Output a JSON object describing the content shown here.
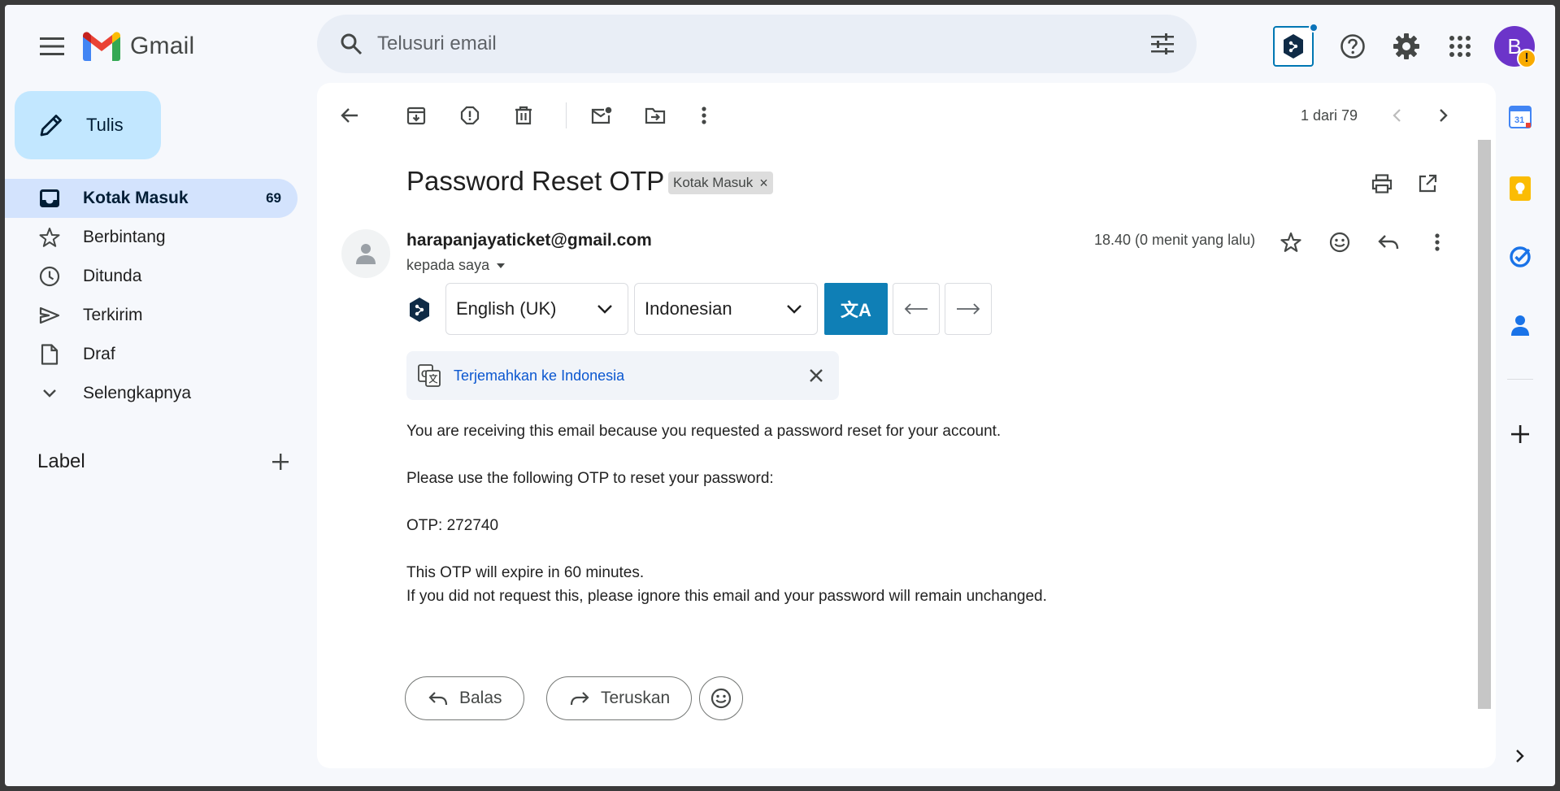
{
  "app": {
    "name": "Gmail"
  },
  "search": {
    "placeholder": "Telusuri email"
  },
  "user": {
    "avatar_initial": "B",
    "warning_glyph": "!"
  },
  "sidebar": {
    "compose_label": "Tulis",
    "items": [
      {
        "label": "Kotak Masuk",
        "count": "69",
        "icon": "inbox-icon"
      },
      {
        "label": "Berbintang",
        "icon": "star-icon"
      },
      {
        "label": "Ditunda",
        "icon": "clock-icon"
      },
      {
        "label": "Terkirim",
        "icon": "send-icon"
      },
      {
        "label": "Draf",
        "icon": "draft-icon"
      },
      {
        "label": "Selengkapnya",
        "icon": "chevron-down-icon"
      }
    ],
    "labels_heading": "Label"
  },
  "toolbar": {
    "pager": "1 dari 79"
  },
  "email": {
    "subject": "Password Reset OTP",
    "label_chip": "Kotak Masuk",
    "chip_close": "×",
    "sender": "harapanjayaticket@gmail.com",
    "to_line": "kepada saya",
    "time": "18.40 (0 menit yang lalu)",
    "body": [
      "You are receiving this email because you requested a password reset for your account.",
      "Please use the following OTP to reset your password:",
      "OTP: 272740",
      "This OTP will expire in 60 minutes.",
      "If you did not request this, please ignore this email and your password will remain unchanged."
    ]
  },
  "translator": {
    "source_lang": "English (UK)",
    "target_lang": "Indonesian",
    "translate_glyph": "文A",
    "google_translate_link": "Terjemahkan ke Indonesia"
  },
  "actions": {
    "reply_label": "Balas",
    "forward_label": "Teruskan"
  },
  "colors": {
    "accent_blue": "#0b57d0",
    "compose_bg": "#c2e7ff",
    "active_nav_bg": "#d3e3fd",
    "deepl_button": "#0f7fb6",
    "avatar_bg": "#6c34c9"
  }
}
